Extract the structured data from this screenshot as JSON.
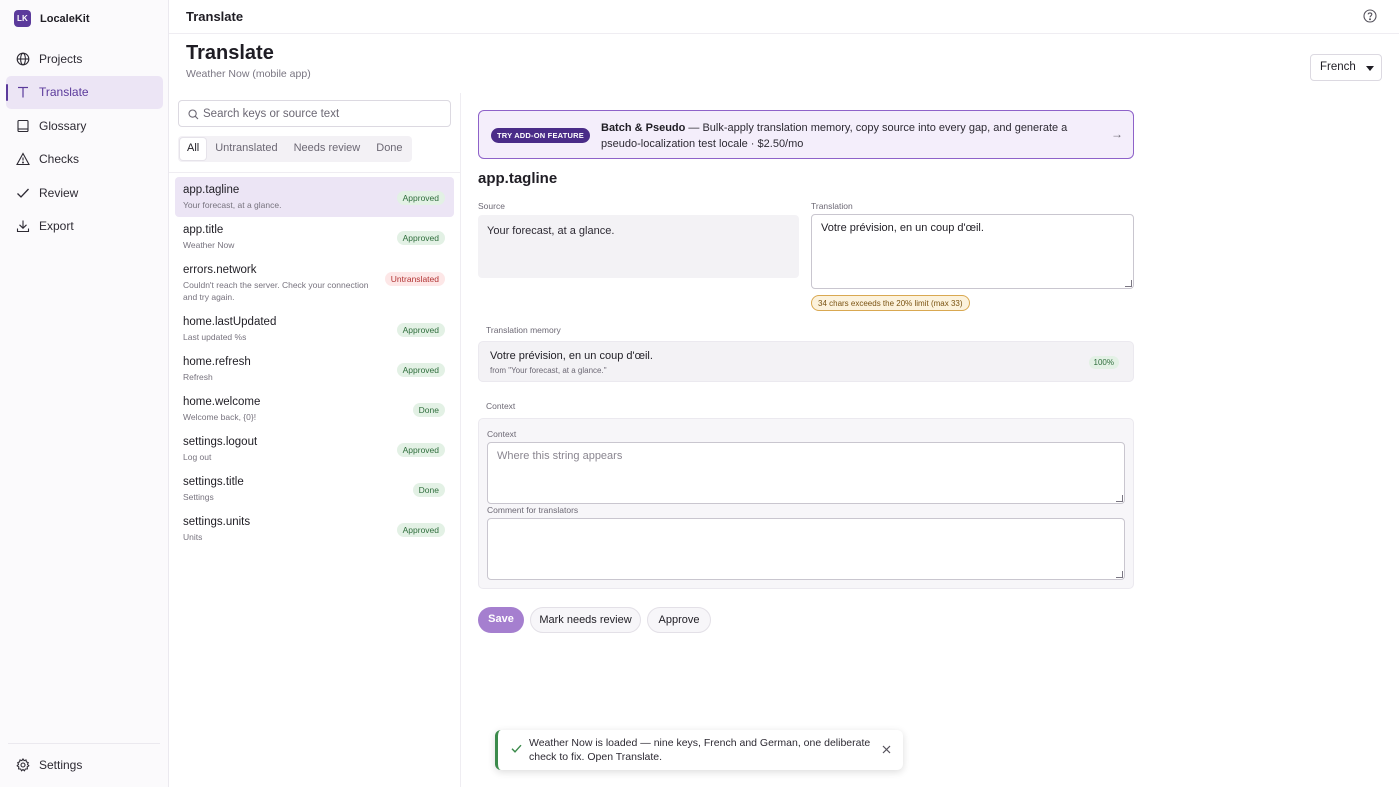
{
  "app": {
    "logo": "LK",
    "name": "LocaleKit"
  },
  "sidebar": {
    "items": [
      {
        "label": "Projects",
        "icon": "globe-icon"
      },
      {
        "label": "Translate",
        "icon": "translate-icon",
        "active": true
      },
      {
        "label": "Glossary",
        "icon": "book-icon"
      },
      {
        "label": "Checks",
        "icon": "warning-triangle-icon"
      },
      {
        "label": "Review",
        "icon": "checkmark-icon"
      },
      {
        "label": "Export",
        "icon": "download-icon"
      }
    ],
    "settings": {
      "label": "Settings",
      "icon": "gear-icon"
    }
  },
  "topbar": {
    "title": "Translate",
    "help_icon": "help-circle-icon"
  },
  "page": {
    "title": "Translate",
    "subtitle": "Weather Now (mobile app)",
    "language": "French"
  },
  "list": {
    "search_placeholder": "Search keys or source text",
    "filters": [
      "All",
      "Untranslated",
      "Needs review",
      "Done"
    ],
    "active_filter": "All",
    "items": [
      {
        "key": "app.tagline",
        "source": "Your forecast, at a glance.",
        "status": "Approved",
        "status_kind": "approved",
        "active": true
      },
      {
        "key": "app.title",
        "source": "Weather Now",
        "status": "Approved",
        "status_kind": "approved"
      },
      {
        "key": "errors.network",
        "source": "Couldn't reach the server. Check your connection and try again.",
        "status": "Untranslated",
        "status_kind": "untranslated"
      },
      {
        "key": "home.lastUpdated",
        "source": "Last updated %s",
        "status": "Approved",
        "status_kind": "approved"
      },
      {
        "key": "home.refresh",
        "source": "Refresh",
        "status": "Approved",
        "status_kind": "approved"
      },
      {
        "key": "home.welcome",
        "source": "Welcome back, {0}!",
        "status": "Done",
        "status_kind": "done"
      },
      {
        "key": "settings.logout",
        "source": "Log out",
        "status": "Approved",
        "status_kind": "approved"
      },
      {
        "key": "settings.title",
        "source": "Settings",
        "status": "Done",
        "status_kind": "done"
      },
      {
        "key": "settings.units",
        "source": "Units",
        "status": "Approved",
        "status_kind": "approved"
      }
    ]
  },
  "addon": {
    "tag": "TRY ADD-ON FEATURE",
    "name": "Batch & Pseudo",
    "description": " — Bulk-apply translation memory, copy source into every gap, and generate a pseudo-localization test locale · $2.50/mo",
    "arrow": "→"
  },
  "editor": {
    "key": "app.tagline",
    "source_label": "Source",
    "source_text": "Your forecast, at a glance.",
    "translation_label": "Translation",
    "translation_value": "Votre prévision, en un coup d'œil.",
    "length_warning": "34 chars exceeds the 20% limit (max 33)",
    "tm_label": "Translation memory",
    "tm_text": "Votre prévision, en un coup d'œil.",
    "tm_from": "from \"Your forecast, at a glance.\"",
    "tm_match": "100%",
    "context_section": "Context",
    "context_label": "Context",
    "context_placeholder": "Where this string appears",
    "context_value": "",
    "comment_label": "Comment for translators",
    "comment_value": "",
    "buttons": {
      "save": "Save",
      "review": "Mark needs review",
      "approve": "Approve"
    }
  },
  "toast": {
    "text": "Weather Now is loaded — nine keys, French and German, one deliberate check to fix. Open Translate.",
    "icon": "check-icon",
    "close_icon": "close-icon"
  },
  "colors": {
    "accent": "#5b3a9b",
    "accent_light": "#ece5f5",
    "save_button": "#a57fcf",
    "approved_bg": "#e3f1e5",
    "untranslated_bg": "#fde7e7",
    "warning_border": "#d9a851"
  }
}
